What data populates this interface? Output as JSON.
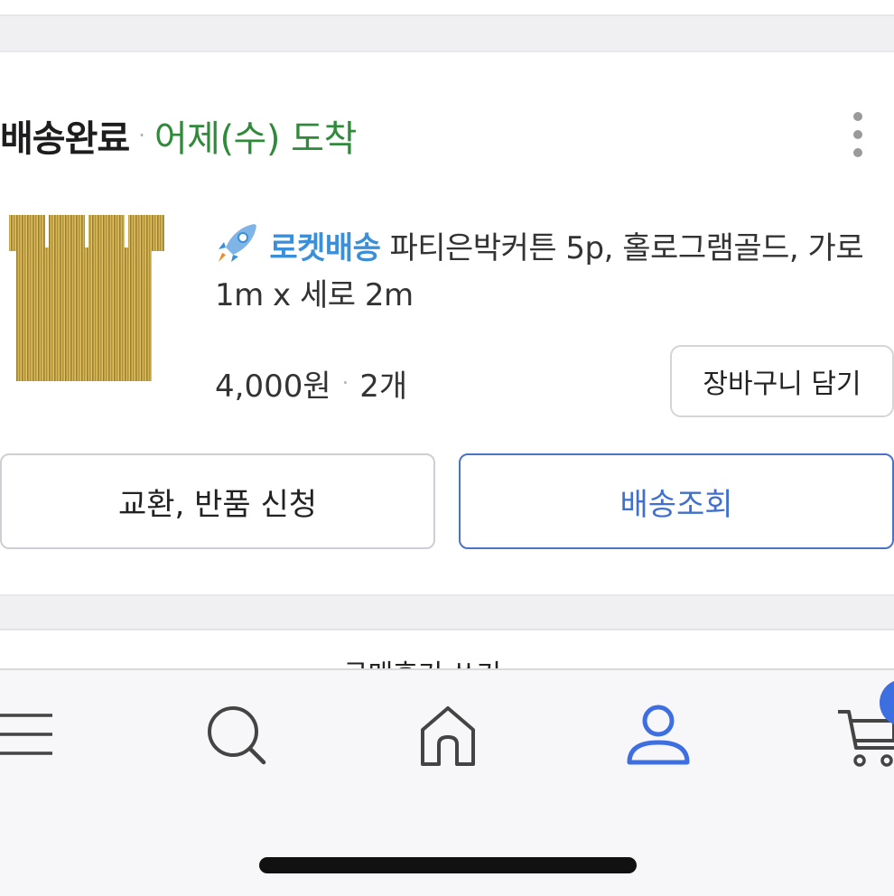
{
  "order": {
    "status": "배송완료",
    "separator": "·",
    "arrival": "어제(수) 도착",
    "more_icon": "more-vertical-icon"
  },
  "product": {
    "badge_icon": "rocket-icon",
    "badge_text": "로켓배송",
    "title": "파티은박커튼 5p, 홀로그램골드, 가로 1m x 세로 2m",
    "price": "4,000원",
    "separator": "·",
    "quantity": "2개",
    "add_to_cart_label": "장바구니 담기"
  },
  "actions": {
    "exchange_label": "교환, 반품 신청",
    "track_label": "배송조회",
    "track_color": "#3f6fcf",
    "status_color": "#2f8a3a",
    "rocket_color": "#3a8fd8"
  },
  "next_section": {
    "label": "구매후기 쓰기"
  },
  "tab_bar": {
    "items": [
      {
        "icon": "menu-icon"
      },
      {
        "icon": "search-icon"
      },
      {
        "icon": "home-icon"
      },
      {
        "icon": "user-icon",
        "active": true
      },
      {
        "icon": "cart-icon"
      }
    ],
    "active_color": "#3d6fe0"
  }
}
